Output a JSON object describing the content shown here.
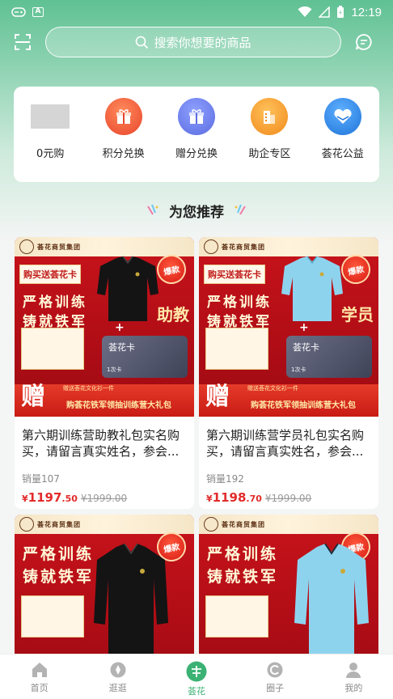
{
  "status_bar": {
    "time": "12:19",
    "icon_a": "A"
  },
  "search": {
    "placeholder": "搜索你想要的商品"
  },
  "categories": [
    {
      "label": "0元购",
      "icon": "placeholder-image"
    },
    {
      "label": "积分兑换",
      "icon": "gift-icon",
      "color": "#f26a46"
    },
    {
      "label": "赠分兑换",
      "icon": "gift-icon",
      "color": "#6a7de8"
    },
    {
      "label": "助企专区",
      "icon": "building-icon",
      "color": "#f59a2a"
    },
    {
      "label": "荟花公益",
      "icon": "heart-hands-icon",
      "color": "#2e86e6"
    }
  ],
  "section": {
    "title": "为您推荐"
  },
  "products": [
    {
      "title": "第六期训练营助教礼包实名购买，请留言真实姓名，参会...",
      "sales": "销量107",
      "price_yen": "¥",
      "price_int": "1197",
      "price_dec": ".50",
      "price_old": "¥1999.00",
      "image": {
        "brand": "荟花商贸集团",
        "buy_tag": "购买送荟花卡",
        "slogan_1": "严格训练",
        "slogan_2": "铸就铁军",
        "hot": "爆款",
        "role": "助教",
        "card_name": "荟花卡",
        "card_count": "1次卡",
        "gift_big": "赠",
        "gift_sub": "赠送荟花文化衫一件",
        "gift_text": "购荟花铁军领抽训练营大礼包"
      },
      "shirt_color": "#141414"
    },
    {
      "title": "第六期训练营学员礼包实名购买，请留言真实姓名，参会...",
      "sales": "销量192",
      "price_yen": "¥",
      "price_int": "1198",
      "price_dec": ".70",
      "price_old": "¥1999.00",
      "image": {
        "brand": "荟花商贸集团",
        "buy_tag": "购买送荟花卡",
        "slogan_1": "严格训练",
        "slogan_2": "铸就铁军",
        "hot": "爆款",
        "role": "学员",
        "card_name": "荟花卡",
        "card_count": "1次卡",
        "gift_big": "赠",
        "gift_sub": "赠送荟花文化衫一件",
        "gift_text": "购荟花铁军领抽训练营大礼包"
      },
      "shirt_color": "#8ed3ee"
    },
    {
      "image": {
        "brand": "荟花商贸集团",
        "slogan_1": "严格训练",
        "slogan_2": "铸就铁军",
        "hot": "爆款"
      },
      "shirt_color": "#141414"
    },
    {
      "image": {
        "brand": "荟花商贸集团",
        "slogan_1": "严格训练",
        "slogan_2": "铸就铁军",
        "hot": "爆款"
      },
      "shirt_color": "#8ed3ee"
    }
  ],
  "bottom_nav": [
    {
      "label": "首页",
      "icon": "home-icon"
    },
    {
      "label": "逛逛",
      "icon": "compass-icon"
    },
    {
      "label": "荟花",
      "icon": "flower-icon",
      "active": true
    },
    {
      "label": "圈子",
      "icon": "circle-icon"
    },
    {
      "label": "我的",
      "icon": "user-icon"
    }
  ],
  "colors": {
    "accent": "#3bb273",
    "price": "#e22b2b",
    "hero": "#5fc193"
  }
}
